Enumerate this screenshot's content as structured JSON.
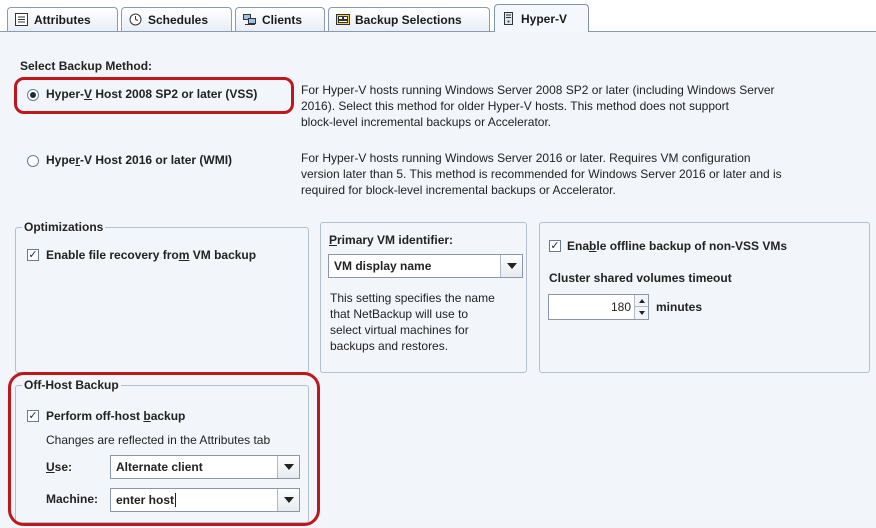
{
  "tabs": [
    {
      "label": "Attributes",
      "icon": "list-icon"
    },
    {
      "label": "Schedules",
      "icon": "clock-icon"
    },
    {
      "label": "Clients",
      "icon": "computers-icon"
    },
    {
      "label": "Backup Selections",
      "icon": "backup-selections-icon"
    },
    {
      "label": "Hyper-V",
      "icon": "server-icon"
    }
  ],
  "backup_method": {
    "heading": "Select Backup Method:",
    "option1": {
      "label_pre": "Hyper-",
      "label_mnemonic": "V",
      "label_post": " Host 2008 SP2 or later (VSS)",
      "selected": true,
      "desc_lines": [
        "For Hyper-V hosts running Windows Server 2008 SP2 or later (including Windows Server",
        "2016). Select this method for older Hyper-V hosts. This method does not support",
        "block-level incremental backups or Accelerator."
      ]
    },
    "option2": {
      "label_pre": "Hype",
      "label_mnemonic": "r",
      "label_post": "-V Host 2016 or later (WMI)",
      "selected": false,
      "desc_lines": [
        "For Hyper-V hosts running Windows Server 2016 or later. Requires VM configuration",
        "version later than 5. This method is recommended for Windows Server 2016 or later and is",
        "required for block-level incremental backups or Accelerator."
      ]
    }
  },
  "optimizations": {
    "legend": "Optimizations",
    "file_recovery_pre": "Enable file recovery fro",
    "file_recovery_mnemonic": "m",
    "file_recovery_post": " VM backup",
    "file_recovery_checked": true
  },
  "primary_vm": {
    "label_mnemonic": "P",
    "label_rest": "rimary VM identifier:",
    "selected": "VM display name",
    "help_lines": [
      "This setting specifies the name",
      "that NetBackup will use to",
      "select virtual machines for",
      "backups and restores."
    ]
  },
  "offline": {
    "label_pre": "Ena",
    "label_mnemonic": "b",
    "label_post": "le offline backup of non-VSS VMs",
    "checked": true,
    "csv_label": "Cluster shared volumes timeout",
    "timeout_value": "180",
    "timeout_unit": "minutes"
  },
  "offhost": {
    "legend": "Off-Host Backup",
    "perform_pre": "Perform off-host ",
    "perform_mnemonic": "b",
    "perform_post": "ackup",
    "perform_checked": true,
    "note": "Changes are reflected in the Attributes tab",
    "use_label_mnemonic": "U",
    "use_label_rest": "se:",
    "use_value": "Alternate client",
    "machine_label": "Machine:",
    "machine_value": "enter host"
  },
  "colors": {
    "highlight": "#c0171e",
    "panel_bg": "#f2f5f9"
  }
}
